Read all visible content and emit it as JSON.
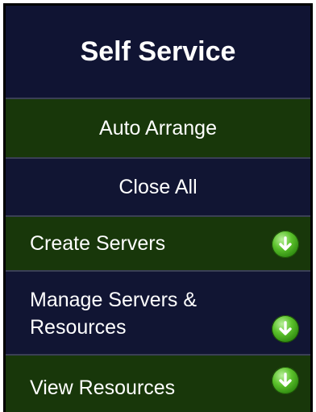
{
  "panel": {
    "title": "Self Service"
  },
  "menu": [
    {
      "label": "Auto Arrange",
      "has_expand": false
    },
    {
      "label": "Close All",
      "has_expand": false
    },
    {
      "label": "Create Servers",
      "has_expand": true,
      "icon": "chevron-down-icon"
    },
    {
      "label_line1": "Manage Servers &",
      "label_line2": "Resources",
      "has_expand": true,
      "icon": "chevron-down-icon"
    },
    {
      "label": "View Resources",
      "has_expand": true,
      "icon": "chevron-down-icon"
    }
  ],
  "colors": {
    "panel_bg": "#0f1330",
    "green_row": "#18370a",
    "navy_row": "#111533",
    "icon_green": "#4cb020",
    "text": "#ffffff"
  }
}
